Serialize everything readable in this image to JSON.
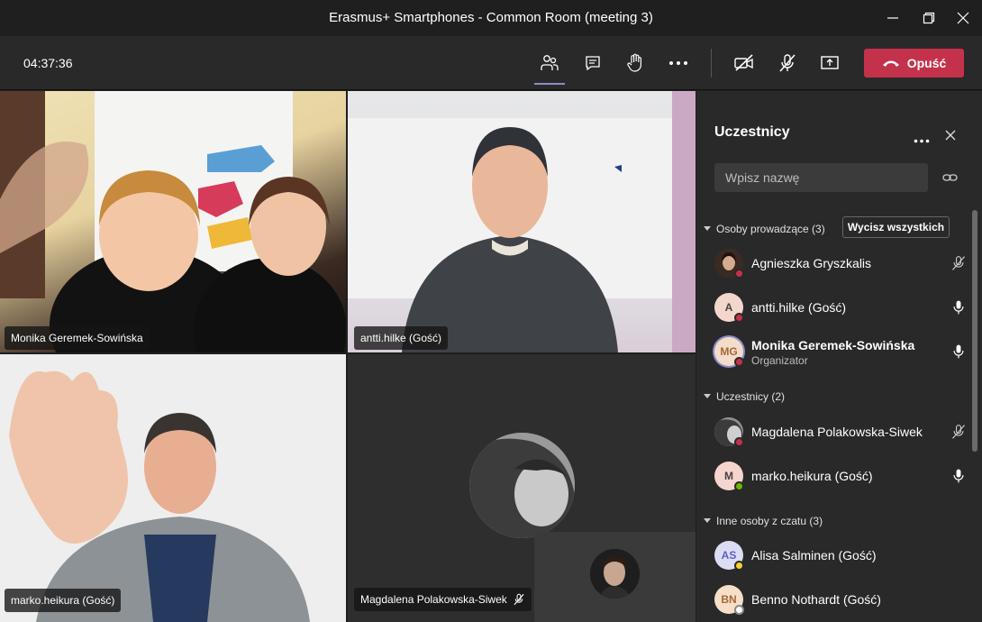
{
  "window": {
    "title": "Erasmus+ Smartphones - Common Room (meeting 3)"
  },
  "toolbar": {
    "timer": "04:37:36",
    "leave_label": "Opuść",
    "leave_color": "#c4314b",
    "icons": [
      "participants-icon",
      "chat-icon",
      "raise-hand-icon",
      "more-icon",
      "camera-off-icon",
      "mic-off-icon",
      "share-screen-icon"
    ]
  },
  "videos": [
    {
      "name": "Monika Geremek-Sowińska"
    },
    {
      "name": "antti.hilke (Gość)"
    },
    {
      "name": "marko.heikura (Gość)"
    },
    {
      "name": "Magdalena Polakowska-Siwek"
    }
  ],
  "panel": {
    "title": "Uczestnicy",
    "search_placeholder": "Wpisz nazwę",
    "mute_all_label": "Wycisz wszystkich",
    "sections": [
      {
        "label": "Osoby prowadzące (3)",
        "people": [
          {
            "name": "Agnieszka Gryszkalis",
            "initials": "",
            "status": "busy",
            "mic": "muted"
          },
          {
            "name": "antti.hilke (Gość)",
            "initials": "A",
            "status": "busy",
            "mic": "on"
          },
          {
            "name": "Monika Geremek-Sowińska",
            "initials": "MG",
            "role": "Organizator",
            "status": "busy",
            "mic": "on"
          }
        ]
      },
      {
        "label": "Uczestnicy (2)",
        "people": [
          {
            "name": "Magdalena Polakowska-Siwek",
            "initials": "",
            "status": "busy",
            "mic": "muted"
          },
          {
            "name": "marko.heikura (Gość)",
            "initials": "M",
            "status": "available",
            "mic": "on"
          }
        ]
      },
      {
        "label": "Inne osoby z czatu (3)",
        "people": [
          {
            "name": "Alisa Salminen (Gość)",
            "initials": "AS",
            "status": "away"
          },
          {
            "name": "Benno Nothardt (Gość)",
            "initials": "BN",
            "status": "offline"
          }
        ]
      }
    ]
  },
  "colors": {
    "busy": "#c4314b",
    "available": "#6bb700",
    "away": "#f8d22a",
    "accent": "#8b8cc7"
  }
}
